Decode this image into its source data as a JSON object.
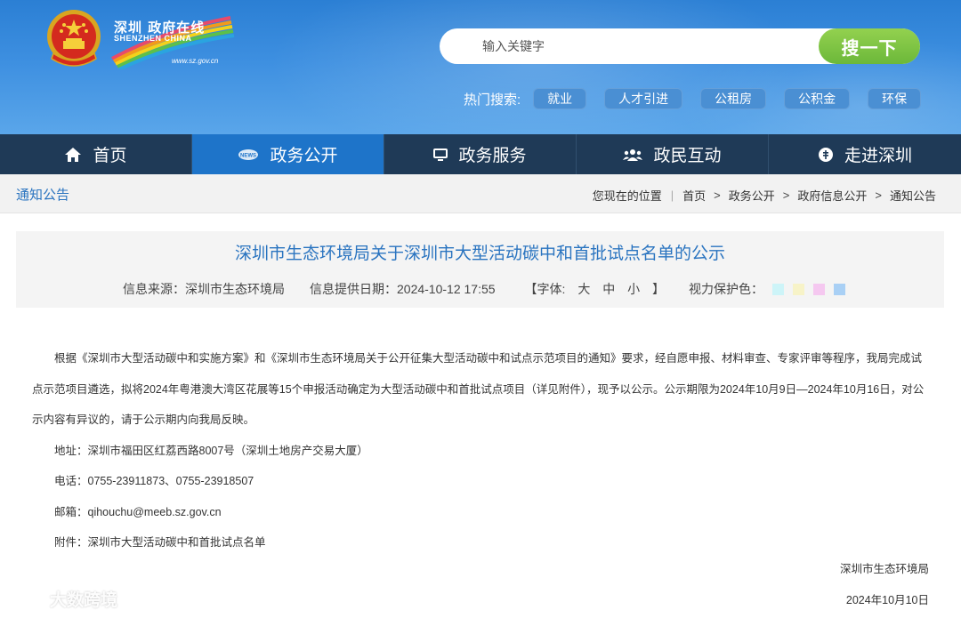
{
  "header": {
    "logo_cn": "深圳 政府在线",
    "logo_en": "SHENZHEN CHINA",
    "logo_url": "www.sz.gov.cn",
    "search_placeholder": "输入关键字",
    "search_button": "搜一下",
    "hot_label": "热门搜索:",
    "hot_tags": [
      "就业",
      "人才引进",
      "公租房",
      "公积金",
      "环保"
    ]
  },
  "nav": {
    "items": [
      {
        "label": "首页",
        "icon": "home-icon"
      },
      {
        "label": "政务公开",
        "icon": "news-icon"
      },
      {
        "label": "政务服务",
        "icon": "monitor-icon"
      },
      {
        "label": "政民互动",
        "icon": "people-icon"
      },
      {
        "label": "走进深圳",
        "icon": "info-icon"
      }
    ],
    "active_index": 1
  },
  "location": {
    "section_title": "通知公告",
    "prefix": "您现在的位置",
    "crumbs": [
      "首页",
      "政务公开",
      "政府信息公开",
      "通知公告"
    ]
  },
  "article": {
    "title": "深圳市生态环境局关于深圳市大型活动碳中和首批试点名单的公示",
    "source": "信息来源：深圳市生态环境局",
    "date": "信息提供日期：2024-10-12 17:55",
    "font_open": "【字体:",
    "font_sizes": [
      "大",
      "中",
      "小"
    ],
    "font_close": "】",
    "eye_label": "视力保护色：",
    "eye_colors": [
      "#cdf4f8",
      "#f7f3c8",
      "#f5c8f0",
      "#a9d0f5"
    ],
    "paragraph": "根据《深圳市大型活动碳中和实施方案》和《深圳市生态环境局关于公开征集大型活动碳中和试点示范项目的通知》要求，经自愿申报、材料审查、专家评审等程序，我局完成试点示范项目遴选，拟将2024年粤港澳大湾区花展等15个申报活动确定为大型活动碳中和首批试点项目（详见附件），现予以公示。公示期限为2024年10月9日—2024年10月16日，对公示内容有异议的，请于公示期内向我局反映。",
    "address": "地址：深圳市福田区红荔西路8007号（深圳土地房产交易大厦）",
    "phone": "电话：0755-23911873、0755-23918507",
    "email": "邮箱：qihouchu@meeb.sz.gov.cn",
    "attachment": "附件：深圳市大型活动碳中和首批试点名单",
    "signer": "深圳市生态环境局",
    "sign_date": "2024年10月10日"
  },
  "watermark": "大数跨境"
}
